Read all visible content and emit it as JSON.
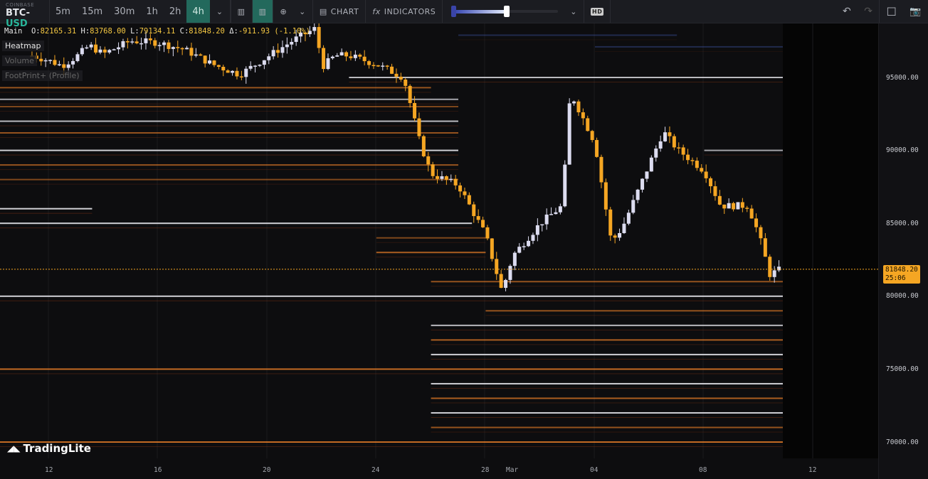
{
  "toolbar": {
    "exchange": "COINBASE",
    "base": "BTC-",
    "quote": "USD",
    "timeframes": [
      "5m",
      "15m",
      "30m",
      "1h",
      "2h",
      "4h"
    ],
    "active_timeframe": "4h",
    "chart_label": "CHART",
    "indicators_label": "INDICATORS",
    "hd_label": "HD",
    "heatmap_range": [
      0.0,
      0.45
    ]
  },
  "legend": {
    "main": "Main",
    "o_label": "O:",
    "o": "82165.31",
    "h_label": "H:",
    "h": "83768.00",
    "l_label": "L:",
    "l": "79134.11",
    "c_label": "C:",
    "c": "81848.20",
    "d_label": "Δ:",
    "d": "-911.93 (-1.10%)"
  },
  "layers": [
    "Heatmap",
    "Volume",
    "FootPrint+ (Profile)"
  ],
  "price_axis": {
    "labels": [
      "95000.00",
      "90000.00",
      "85000.00",
      "80000.00",
      "75000.00",
      "70000.00"
    ],
    "last_price": "81848.20",
    "countdown": "25:06"
  },
  "time_axis": {
    "labels": [
      "12",
      "16",
      "20",
      "24",
      "28",
      "Mar",
      "04",
      "08",
      "12"
    ]
  },
  "brand": "TradingLite",
  "colors": {
    "up": "#dcdcf0",
    "down": "#f5a623",
    "accent": "#23695c"
  },
  "chart_data": {
    "type": "candlestick",
    "interval": "4h",
    "price_range": [
      69000,
      98800
    ],
    "key_closes_by_day": [
      [
        -0.6,
        96500
      ],
      [
        0,
        96170
      ],
      [
        0.5,
        95800
      ],
      [
        1,
        96400
      ],
      [
        1.5,
        97200
      ],
      [
        2,
        96600
      ],
      [
        3,
        97500
      ],
      [
        4,
        97400
      ],
      [
        5,
        96900
      ],
      [
        6,
        95900
      ],
      [
        7,
        95200
      ],
      [
        8,
        96400
      ],
      [
        9,
        97600
      ],
      [
        9.8,
        98400
      ],
      [
        10,
        95700
      ],
      [
        10.5,
        96500
      ],
      [
        11,
        96500
      ],
      [
        12,
        95900
      ],
      [
        13,
        95000
      ],
      [
        13.6,
        90500
      ],
      [
        14,
        88400
      ],
      [
        15,
        87600
      ],
      [
        16,
        84200
      ],
      [
        16.6,
        80300
      ],
      [
        17,
        82800
      ],
      [
        18,
        85000
      ],
      [
        18.8,
        86200
      ],
      [
        19.1,
        94000
      ],
      [
        20,
        90500
      ],
      [
        20.6,
        83700
      ],
      [
        21,
        84700
      ],
      [
        22,
        89100
      ],
      [
        22.5,
        91300
      ],
      [
        23,
        90100
      ],
      [
        24,
        88600
      ],
      [
        24.6,
        86200
      ],
      [
        25.6,
        86200
      ],
      [
        26,
        84200
      ],
      [
        26.4,
        81500
      ],
      [
        26.8,
        81848
      ]
    ],
    "heatmap_levels": [
      [
        97900,
        15,
        23,
        0.3,
        "blue"
      ],
      [
        97100,
        20,
        28,
        0.3,
        "blue"
      ],
      [
        95000,
        11,
        28,
        0.8,
        "white"
      ],
      [
        94300,
        -2,
        14,
        0.6,
        "orange"
      ],
      [
        93500,
        -2,
        15,
        0.7,
        "white"
      ],
      [
        93000,
        -2,
        15,
        0.5,
        "orange"
      ],
      [
        92000,
        -2,
        15,
        0.8,
        "white"
      ],
      [
        91200,
        -2,
        15,
        0.6,
        "orange"
      ],
      [
        90000,
        -2,
        15,
        0.9,
        "white"
      ],
      [
        90000,
        24,
        28,
        0.7,
        "white"
      ],
      [
        89000,
        -2,
        15,
        0.6,
        "orange"
      ],
      [
        88000,
        -2,
        15,
        0.5,
        "orange"
      ],
      [
        86000,
        -2,
        1.6,
        0.9,
        "white"
      ],
      [
        85000,
        -2,
        15.5,
        0.9,
        "white"
      ],
      [
        84000,
        12,
        16,
        0.5,
        "orange"
      ],
      [
        83000,
        12,
        16,
        0.7,
        "orange"
      ],
      [
        81000,
        14,
        28,
        0.6,
        "orange"
      ],
      [
        80000,
        -2,
        28,
        0.9,
        "white"
      ],
      [
        79000,
        16,
        28,
        0.6,
        "orange"
      ],
      [
        78000,
        14,
        28,
        0.8,
        "white"
      ],
      [
        77000,
        14,
        28,
        0.7,
        "orange"
      ],
      [
        76000,
        14,
        28,
        0.9,
        "white"
      ],
      [
        75000,
        -2,
        28,
        0.8,
        "orange"
      ],
      [
        74000,
        14,
        28,
        0.9,
        "white"
      ],
      [
        73000,
        14,
        28,
        0.7,
        "orange"
      ],
      [
        72000,
        14,
        28,
        0.9,
        "white"
      ],
      [
        71000,
        14,
        28,
        0.6,
        "orange"
      ],
      [
        70000,
        -2,
        28,
        0.8,
        "orange"
      ]
    ]
  }
}
